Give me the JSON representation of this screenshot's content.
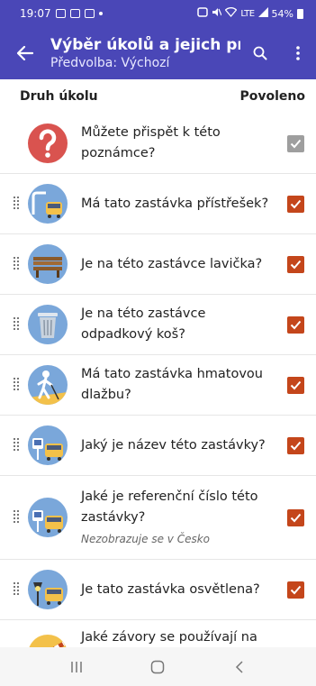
{
  "status": {
    "time": "19:07",
    "battery": "54%",
    "network": "LTE"
  },
  "app_bar": {
    "title": "Výběr úkolů a jejich pr…",
    "subtitle": "Předvolba: Výchozí"
  },
  "header": {
    "left": "Druh úkolu",
    "right": "Povoleno"
  },
  "items": [
    {
      "icon": "question-mark-icon",
      "text": "Můžete přispět k této poznámce?",
      "enabled": true,
      "toggleable": false,
      "draggable": false
    },
    {
      "icon": "bus-shelter-icon",
      "text": "Má tato zastávka přístřešek?",
      "enabled": true,
      "toggleable": true,
      "draggable": true
    },
    {
      "icon": "bench-icon",
      "text": "Je na této zastávce lavička?",
      "enabled": true,
      "toggleable": true,
      "draggable": true
    },
    {
      "icon": "trash-bin-icon",
      "text": "Je na této zastávce odpadkový koš?",
      "enabled": true,
      "toggleable": true,
      "draggable": true
    },
    {
      "icon": "tactile-paving-icon",
      "text": "Má tato zastávka hmatovou dlažbu?",
      "enabled": true,
      "toggleable": true,
      "draggable": true
    },
    {
      "icon": "bus-stop-name-icon",
      "text": "Jaký je název této zastávky?",
      "enabled": true,
      "toggleable": true,
      "draggable": true
    },
    {
      "icon": "bus-stop-ref-icon",
      "text": "Jaké je referenční číslo této zastávky?",
      "note": "Nezobrazuje se v Česko",
      "enabled": true,
      "toggleable": true,
      "draggable": true
    },
    {
      "icon": "bus-stop-lit-icon",
      "text": "Je tato zastávka osvětlena?",
      "enabled": true,
      "toggleable": true,
      "draggable": true
    },
    {
      "icon": "railway-crossing-barrier-icon",
      "text": "Jaké závory se používají na tomto železničním",
      "enabled": true,
      "toggleable": true,
      "draggable": true
    }
  ],
  "colors": {
    "app_bar": "#4a47b7",
    "checkbox_on": "#c4461b",
    "checkbox_disabled": "#9e9e9e",
    "icon_bg": "#7aa7da",
    "question_icon": "#d9534f"
  }
}
